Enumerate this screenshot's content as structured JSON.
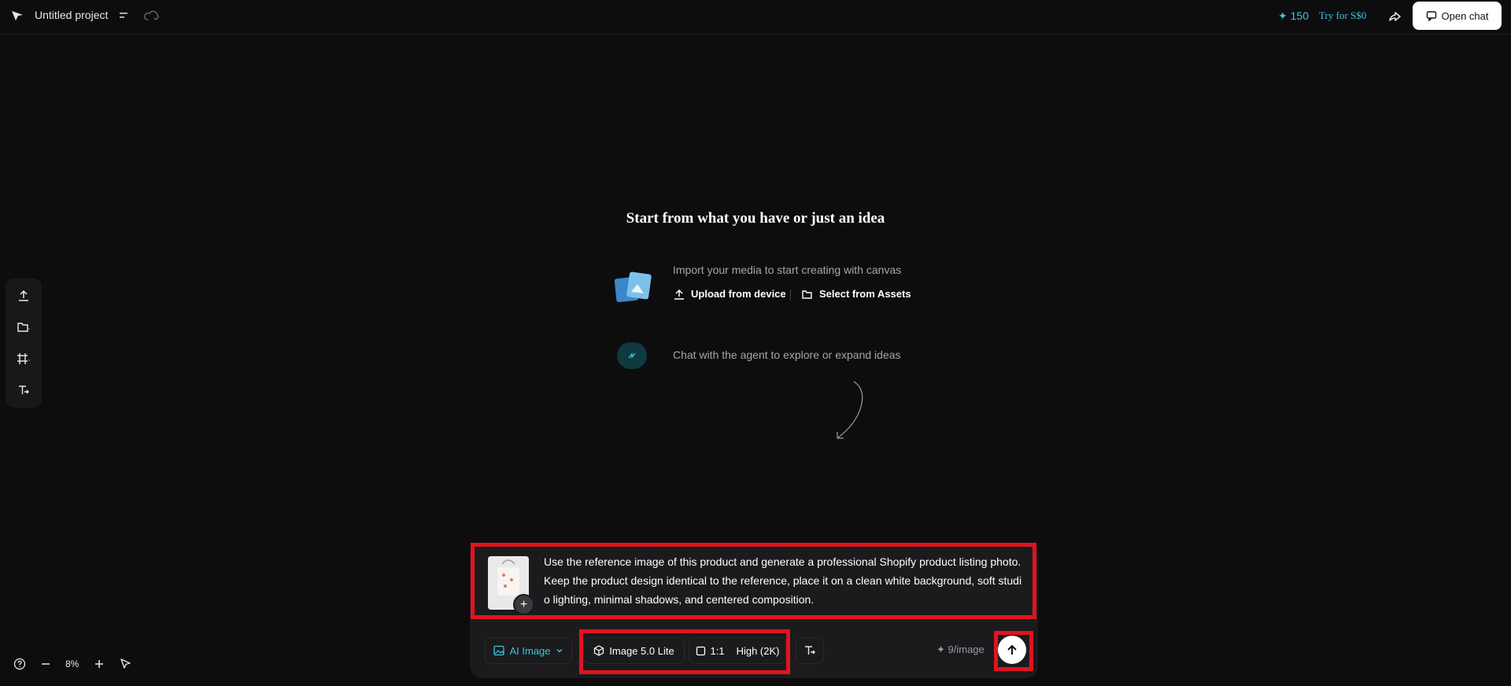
{
  "header": {
    "project_title": "Untitled project",
    "credits": "✦ 150",
    "try_label": "Try for S$0",
    "open_chat_label": "Open chat"
  },
  "welcome": {
    "title": "Start from what you have or just an idea",
    "import_text": "Import your media to start creating with canvas",
    "upload_label": "Upload from device",
    "assets_label": "Select from Assets",
    "agent_text": "Chat with the agent to explore or expand ideas"
  },
  "composer": {
    "prompt": "Use the reference image of this product and generate a professional Shopify product listing photo. Keep the product design identical to the reference, place it on a clean white background, soft studio lighting, minimal shadows, and centered composition.",
    "mode_label": "AI Image",
    "model_label": "Image 5.0 Lite",
    "ratio_label": "1:1",
    "quality_label": "High (2K)",
    "cost_label": "✦ 9/image"
  },
  "footer": {
    "zoom": "8%"
  },
  "colors": {
    "accent": "#3fc4e0",
    "highlight": "#e0141e",
    "background": "#0d0d0e"
  }
}
